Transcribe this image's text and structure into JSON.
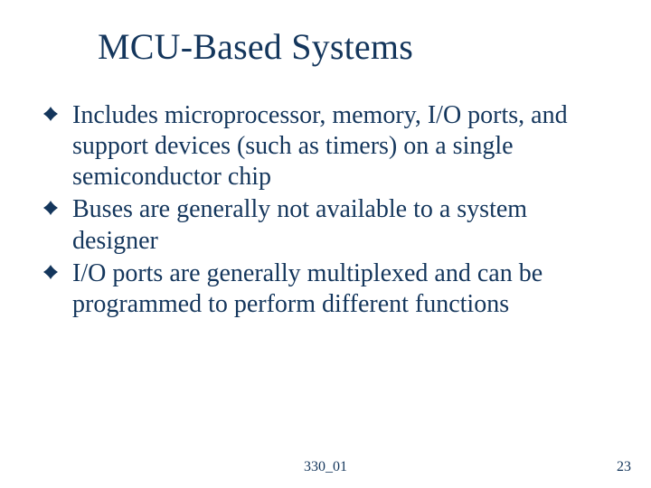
{
  "title": "MCU-Based Systems",
  "bullets": [
    "Includes microprocessor, memory, I/O ports, and support devices (such as timers) on a single semiconductor chip",
    "Buses are generally not available to a system designer",
    "I/O ports are generally multiplexed and can be programmed to perform different functions"
  ],
  "footer_center": "330_01",
  "page_number": "23",
  "colors": {
    "text": "#14365c"
  }
}
